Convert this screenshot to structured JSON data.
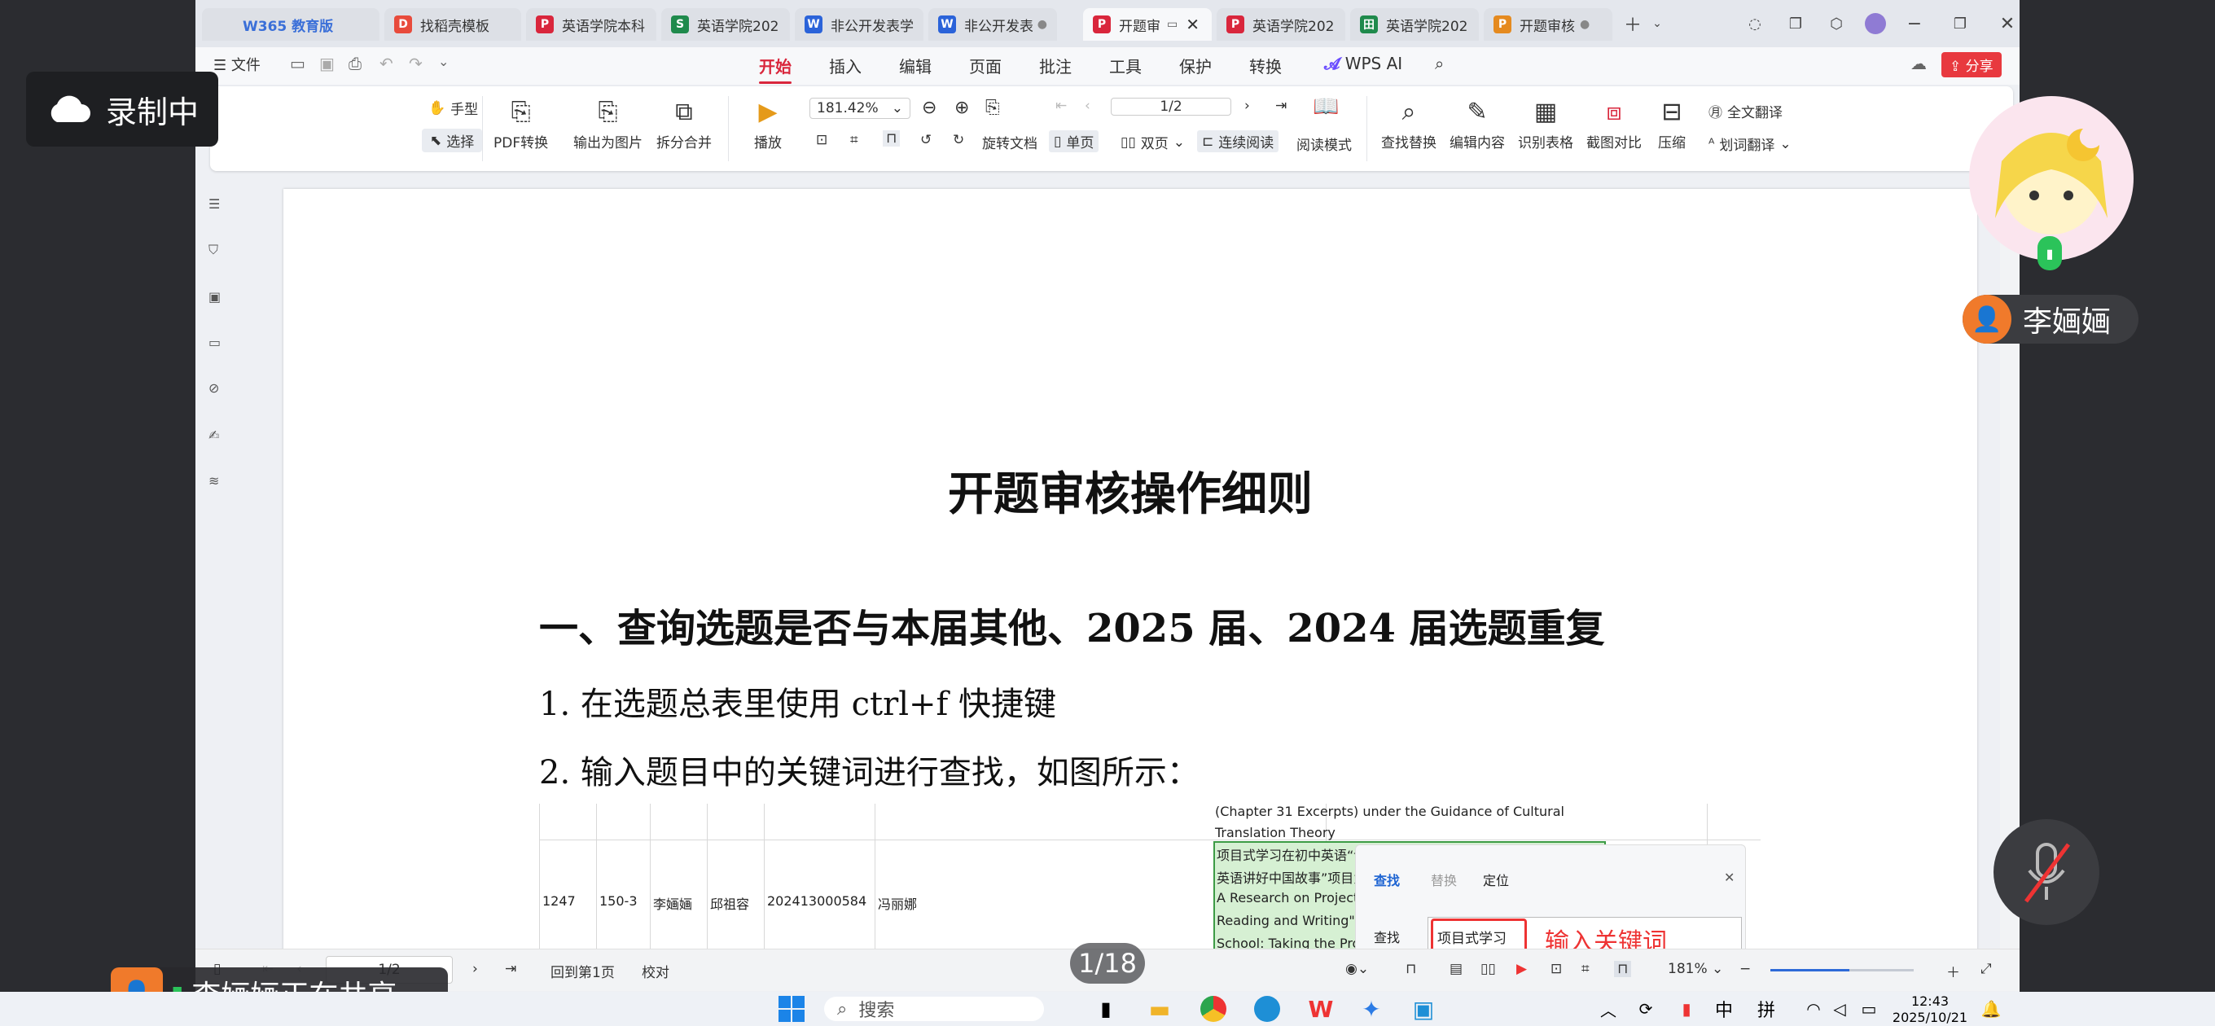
{
  "tabs": [
    {
      "label": "W365 教育版",
      "color": "#3a6fd8",
      "glyph": "W"
    },
    {
      "label": "找稻壳模板",
      "color": "#e84b3c",
      "glyph": "D"
    },
    {
      "label": "英语学院本科",
      "color": "#d9263c",
      "glyph": "P"
    },
    {
      "label": "英语学院202",
      "color": "#1f8a4c",
      "glyph": "S"
    },
    {
      "label": "非公开发表学",
      "color": "#2b63d9",
      "glyph": "W"
    },
    {
      "label": "非公开发表",
      "color": "#2b63d9",
      "glyph": "W"
    },
    {
      "label": "开题审",
      "color": "#d9263c",
      "glyph": "P"
    },
    {
      "label": "英语学院202",
      "color": "#d9263c",
      "glyph": "P"
    },
    {
      "label": "英语学院202",
      "color": "#1f8a4c",
      "glyph": "田"
    },
    {
      "label": "开题审核",
      "color": "#e58a1f",
      "glyph": "P"
    }
  ],
  "menu": {
    "file": "文件",
    "items": [
      "开始",
      "插入",
      "编辑",
      "页面",
      "批注",
      "工具",
      "保护",
      "转换"
    ],
    "wps_ai": "WPS AI",
    "share": "分享"
  },
  "ribbon": {
    "hand": "手型",
    "select": "选择",
    "pdf_convert": "PDF转换",
    "export_image": "输出为图片",
    "split_merge": "拆分合并",
    "play": "播放",
    "zoom": "181.42%",
    "page": "1/2",
    "rotate": "旋转文档",
    "single": "单页",
    "double": "双页",
    "continuous": "连续阅读",
    "read_mode": "阅读模式",
    "find_replace": "查找替换",
    "edit_content": "编辑内容",
    "recognize_table": "识别表格",
    "screenshot_compare": "截图对比",
    "compress": "压缩",
    "full_translate": "全文翻译",
    "word_translate": "划词翻译"
  },
  "doc": {
    "title": "开题审核操作细则",
    "h1": "一、查询选题是否与本届其他、2025 届、2024 届选题重复",
    "p1": "1.  在选题总表里使用 ctrl+f 快捷键",
    "p2": "2.  输入题目中的关键词进行查找，如图所示："
  },
  "sheet": {
    "top_line1": "(Chapter 31 Excerpts) under the Guidance of Cultural",
    "top_line2": "Translation Theory",
    "row": [
      "1247",
      "150-3",
      "李婳婳",
      "邱祖容",
      "202413000584",
      "冯丽娜"
    ],
    "cn_title1": "项目式学习在初中英语“读写融合”教学中的实践研究——以“用",
    "cn_title2": "英语讲好中国故事”项目为例",
    "en1": "A Research on Project-Based Learning in \"Integration of",
    "en2": "Reading and Writing\" of Teaching English in Junior High",
    "en3": "School: Taking the Project \"Telling China's Stories Well in",
    "find_tabs": [
      "查找",
      "替换",
      "定位"
    ],
    "find_label": "查找",
    "find_value": "项目式学习",
    "find_overlay": "输入关键词"
  },
  "status": {
    "page": "1/2",
    "back": "回到第1页",
    "proofread": "校对",
    "zoom": "181%",
    "zoom_fraction": 0.55
  },
  "overlays": {
    "recording": "录制中",
    "user": "李婳婳",
    "sharing": "李婳婳正在共享",
    "page_counter": "1/18"
  },
  "taskbar": {
    "search": "搜索",
    "lang1": "中",
    "lang2": "拼",
    "time": "12:43",
    "date": "2025/10/21"
  }
}
